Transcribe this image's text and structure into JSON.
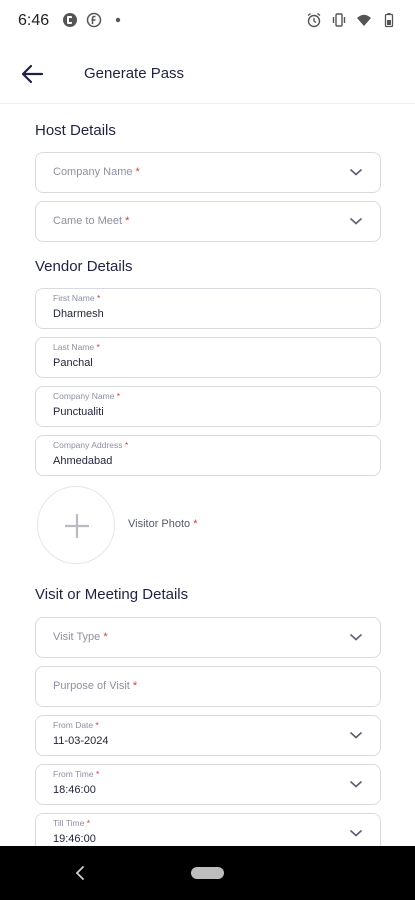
{
  "status_bar": {
    "time": "6:46",
    "left_icons": [
      "notification-app-icon",
      "notification-app-icon-2",
      "dot-icon"
    ],
    "right_icons": [
      "alarm-icon",
      "vibrate-icon",
      "wifi-icon",
      "battery-icon"
    ]
  },
  "app_bar": {
    "title": "Generate Pass"
  },
  "host_details": {
    "title": "Host Details",
    "company_name": {
      "placeholder": "Company Name"
    },
    "came_to_meet": {
      "placeholder": "Came to Meet"
    }
  },
  "vendor_details": {
    "title": "Vendor Details",
    "first_name": {
      "label": "First Name",
      "value": "Dharmesh"
    },
    "last_name": {
      "label": "Last Name",
      "value": "Panchal"
    },
    "company_name": {
      "label": "Company Name",
      "value": "Punctualiti"
    },
    "company_address": {
      "label": "Company Address",
      "value": "Ahmedabad"
    },
    "visitor_photo": {
      "label": "Visitor Photo"
    }
  },
  "visit_details": {
    "title": "Visit or Meeting Details",
    "visit_type": {
      "placeholder": "Visit Type"
    },
    "purpose": {
      "placeholder": "Purpose of Visit"
    },
    "from_date": {
      "label": "From Date",
      "value": "11-03-2024"
    },
    "from_time": {
      "label": "From Time",
      "value": "18:46:00"
    },
    "till_time": {
      "label": "Till Time",
      "value": "19:46:00"
    }
  },
  "required_marker": "*",
  "colors": {
    "accent_text": "#1f2340",
    "required": "#d23a3a",
    "border": "#d9dbe0",
    "nav_bar": "#000000"
  }
}
